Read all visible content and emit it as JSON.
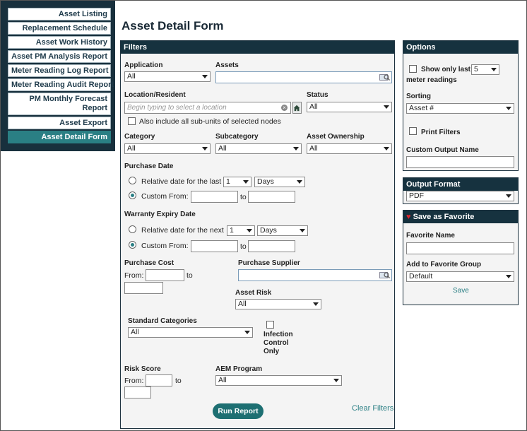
{
  "sidebar": {
    "items": [
      {
        "label": "Asset Listing"
      },
      {
        "label": "Replacement Schedule"
      },
      {
        "label": "Asset Work History"
      },
      {
        "label": "Asset PM Analysis Report"
      },
      {
        "label": "Meter Reading Log Report"
      },
      {
        "label": "Meter Reading Audit Report"
      },
      {
        "label": "PM Monthly Forecast Report"
      },
      {
        "label": "Asset Export"
      },
      {
        "label": "Asset Detail Form",
        "active": true
      }
    ]
  },
  "page": {
    "title": "Asset Detail Form"
  },
  "filters": {
    "header": "Filters",
    "application_label": "Application",
    "application_value": "All",
    "assets_label": "Assets",
    "location_label": "Location/Resident",
    "location_placeholder": "Begin typing to select a location",
    "status_label": "Status",
    "status_value": "All",
    "subunits_label": "Also include all sub-units of selected nodes",
    "category_label": "Category",
    "category_value": "All",
    "subcategory_label": "Subcategory",
    "subcategory_value": "All",
    "ownership_label": "Asset Ownership",
    "ownership_value": "All",
    "purchase_date_label": "Purchase Date",
    "purchase_relative_label": "Relative date for the last",
    "purchase_relative_count": "1",
    "purchase_relative_unit": "Days",
    "purchase_custom_label": "Custom From:",
    "purchase_to": "to",
    "warranty_label": "Warranty Expiry Date",
    "warranty_relative_label": "Relative date for the next",
    "warranty_relative_count": "1",
    "warranty_relative_unit": "Days",
    "warranty_custom_label": "Custom From:",
    "warranty_to": "to",
    "cost_label": "Purchase Cost",
    "cost_from": "From:",
    "cost_to": "to",
    "supplier_label": "Purchase Supplier",
    "risk_label": "Asset Risk",
    "risk_value": "All",
    "std_categories_label": "Standard Categories",
    "std_categories_value": "All",
    "infection_label_1": "Infection",
    "infection_label_2": "Control",
    "infection_label_3": "Only",
    "risk_score_label": "Risk Score",
    "risk_score_from": "From:",
    "risk_score_to": "to",
    "aem_label": "AEM Program",
    "aem_value": "All",
    "run_report": "Run Report",
    "clear_filters": "Clear Filters"
  },
  "options": {
    "header": "Options",
    "show_only_last": "Show only last",
    "meter_count": "5",
    "meter_readings": "meter readings",
    "sorting_label": "Sorting",
    "sorting_value": "Asset #",
    "print_filters": "Print Filters",
    "custom_output_label": "Custom Output Name"
  },
  "output": {
    "header": "Output Format",
    "value": "PDF"
  },
  "favorite": {
    "header": "Save as Favorite",
    "name_label": "Favorite Name",
    "group_label": "Add to Favorite Group",
    "group_value": "Default",
    "save": "Save"
  }
}
